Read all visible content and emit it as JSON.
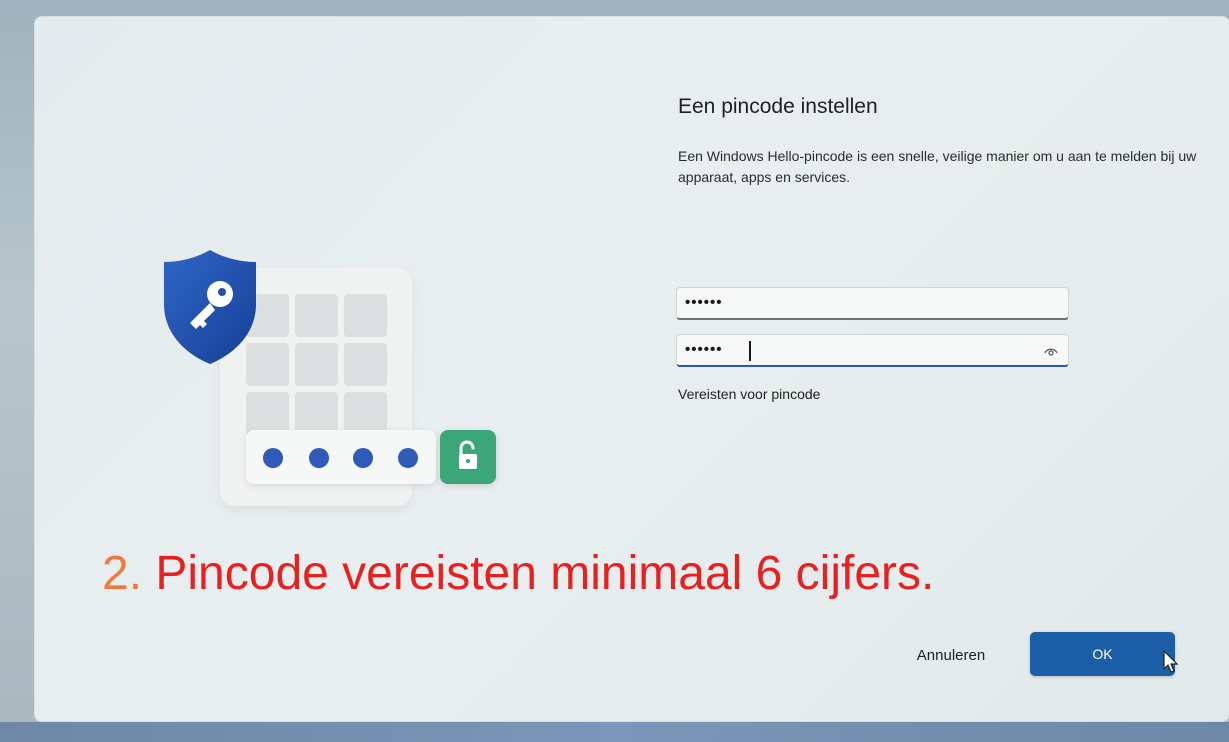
{
  "setup": {
    "title": "Een pincode instellen",
    "description": "Een Windows Hello-pincode is een snelle, veilige manier om u aan te melden bij uw apparaat, apps en services.",
    "pin_field": {
      "value": "••••••"
    },
    "confirm_field": {
      "value": "••••••",
      "reveal_icon": "eye-icon"
    },
    "requirements_link": "Vereisten voor pincode",
    "cancel_button": "Annuleren",
    "ok_button": "OK"
  },
  "annotation": {
    "number": "2.",
    "text": " Pincode vereisten minimaal 6 cijfers."
  },
  "illustration": {
    "shield_icon": "shield-key-icon",
    "lock_icon": "unlock-icon",
    "pin_dots": 4
  },
  "colors": {
    "accent": "#1d5fa6",
    "shield": "#1f4fb0",
    "lock_tile": "#3aa67a",
    "annotation_number": "#f07a3a",
    "annotation_text": "#e82020"
  }
}
